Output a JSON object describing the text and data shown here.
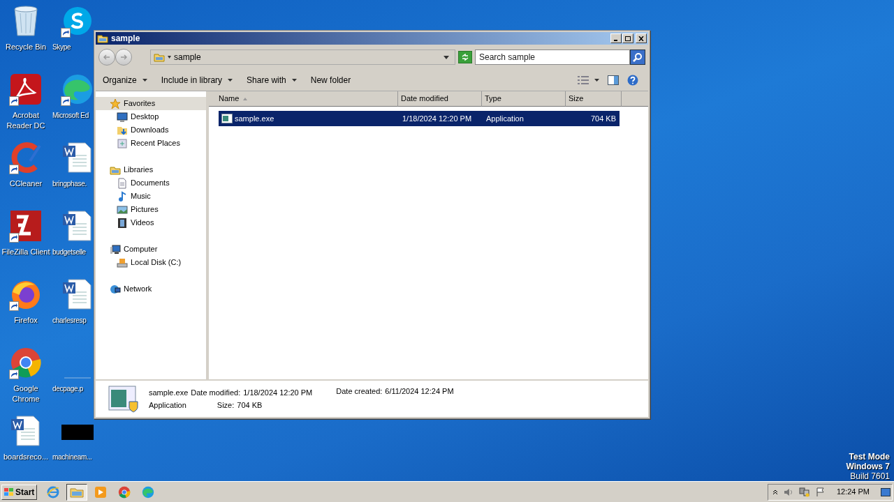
{
  "desktop": {
    "icons": [
      {
        "label": "Recycle Bin",
        "kind": "recycle",
        "shortcut": false
      },
      {
        "label": "Acrobat Reader DC",
        "kind": "acrobat",
        "shortcut": true
      },
      {
        "label": "CCleaner",
        "kind": "ccleaner",
        "shortcut": true
      },
      {
        "label": "FileZilla Client",
        "kind": "filezilla",
        "shortcut": true
      },
      {
        "label": "Firefox",
        "kind": "firefox",
        "shortcut": true
      },
      {
        "label": "Google Chrome",
        "kind": "chrome",
        "shortcut": true
      },
      {
        "label": "boardsreco...",
        "kind": "word",
        "shortcut": false
      },
      {
        "label": "Skype",
        "kind": "skype",
        "shortcut": true
      },
      {
        "label": "Microsoft Ed",
        "kind": "edge",
        "shortcut": true
      },
      {
        "label": "bringphase.",
        "kind": "word",
        "shortcut": false
      },
      {
        "label": "budgetselle",
        "kind": "word",
        "shortcut": false
      },
      {
        "label": "charlesresp",
        "kind": "word",
        "shortcut": false
      },
      {
        "label": "decpage.p",
        "kind": "blank",
        "shortcut": false
      },
      {
        "label": "machineam...",
        "kind": "blackbox",
        "shortcut": false
      }
    ],
    "system_notice": [
      "Test Mode",
      "Windows 7",
      "Build 7601"
    ]
  },
  "window": {
    "title": "sample",
    "address": "sample",
    "search": {
      "placeholder": "Search sample"
    },
    "toolbar": [
      {
        "label": "Organize",
        "dropdown": true
      },
      {
        "label": "Include in library",
        "dropdown": true
      },
      {
        "label": "Share with",
        "dropdown": true
      },
      {
        "label": "New folder",
        "dropdown": false
      }
    ],
    "nav_pane": [
      {
        "label": "Favorites",
        "selected": true,
        "children": [
          {
            "label": "Desktop",
            "selected": false
          },
          {
            "label": "Downloads",
            "selected": false
          },
          {
            "label": "Recent Places",
            "selected": false
          }
        ]
      },
      {
        "label": "Libraries",
        "selected": false,
        "children": [
          {
            "label": "Documents",
            "selected": false
          },
          {
            "label": "Music",
            "selected": false
          },
          {
            "label": "Pictures",
            "selected": false
          },
          {
            "label": "Videos",
            "selected": false
          }
        ]
      },
      {
        "label": "Computer",
        "selected": false,
        "children": [
          {
            "label": "Local Disk (C:)",
            "selected": false
          }
        ]
      },
      {
        "label": "Network",
        "selected": false
      }
    ],
    "columns": [
      {
        "label": "Name",
        "sorted": true
      },
      {
        "label": "Date modified",
        "sorted": false
      },
      {
        "label": "Type",
        "sorted": false
      },
      {
        "label": "Size",
        "sorted": false
      }
    ],
    "files": [
      {
        "name": "sample.exe",
        "date_modified": "1/18/2024 12:20 PM",
        "type": "Application",
        "size": "704 KB",
        "selected": true
      }
    ],
    "details": {
      "name": "sample.exe",
      "type": "Application",
      "fields": [
        {
          "label": "Date modified:",
          "value": "1/18/2024 12:20 PM"
        },
        {
          "label": "Size:",
          "value": "704 KB"
        },
        {
          "label": "Date created:",
          "value": "6/11/2024 12:24 PM"
        }
      ]
    }
  },
  "taskbar": {
    "start": "Start",
    "apps": [
      {
        "kind": "ie",
        "active": false
      },
      {
        "kind": "explorer",
        "active": true
      },
      {
        "kind": "media",
        "active": false
      },
      {
        "kind": "chrome",
        "active": false
      },
      {
        "kind": "edge",
        "active": false
      }
    ],
    "clock": "12:24 PM"
  }
}
